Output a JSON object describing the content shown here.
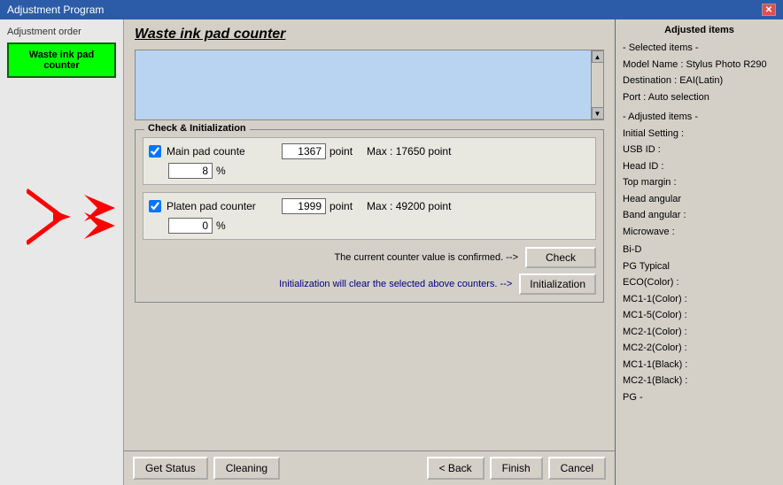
{
  "titlebar": {
    "title": "Adjustment Program",
    "close_label": "✕"
  },
  "left_panel": {
    "header": "Adjustment order",
    "waste_pad_btn": "Waste ink pad counter"
  },
  "center_panel": {
    "title": "Waste ink pad counter",
    "check_init_label": "Check & Initialization",
    "main_pad": {
      "label": "Main pad counte",
      "checked": true,
      "value": "1367",
      "unit": "point",
      "max_text": "Max : 17650 point",
      "percent_value": "8",
      "percent_unit": "%"
    },
    "platen_pad": {
      "label": "Platen pad counter",
      "checked": true,
      "value": "1999",
      "unit": "point",
      "max_text": "Max : 49200 point",
      "percent_value": "0",
      "percent_unit": "%"
    },
    "confirmed_text": "The current counter value is confirmed. -->",
    "check_btn": "Check",
    "init_text": "Initialization will clear the selected above counters. -->",
    "init_btn": "Initialization",
    "toolbar": {
      "get_status": "Get Status",
      "cleaning": "Cleaning",
      "back": "< Back",
      "finish": "Finish",
      "cancel": "Cancel"
    }
  },
  "right_panel": {
    "title": "Adjusted items",
    "selected_items_label": "- Selected items -",
    "model_name": "Model Name : Stylus Photo R290",
    "destination": "Destination : EAI(Latin)",
    "port": "Port : Auto selection",
    "adjusted_items_label": "- Adjusted items -",
    "initial_setting": "Initial Setting :",
    "usb_id": "USB ID :",
    "head_id": "Head ID :",
    "top_margin": "Top margin :",
    "head_angular": "Head angular",
    "band_angular": "Band angular :",
    "microwave": "Microwave :",
    "bi_d": "Bi-D",
    "pg_typical": "PG Typical",
    "eco_color": "ECO(Color) :",
    "mc1_1_color": "MC1-1(Color) :",
    "mc1_5_color": "MC1-5(Color) :",
    "mc2_1_color": "MC2-1(Color) :",
    "mc2_2_color": "MC2-2(Color) :",
    "mc1_1_black": "MC1-1(Black) :",
    "mc2_1_black": "MC2-1(Black) :",
    "pg": "PG -"
  }
}
